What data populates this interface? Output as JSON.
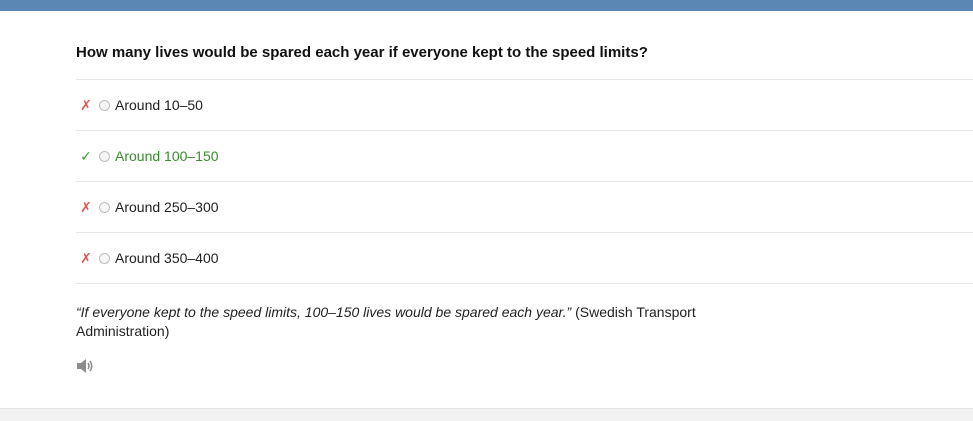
{
  "question": {
    "text": "How many lives would be spared each year if everyone kept to the speed limits?"
  },
  "options": [
    {
      "label": "Around 10–50",
      "mark": "✗",
      "correct": false
    },
    {
      "label": "Around 100–150",
      "mark": "✓",
      "correct": true
    },
    {
      "label": "Around 250–300",
      "mark": "✗",
      "correct": false
    },
    {
      "label": "Around 350–400",
      "mark": "✗",
      "correct": false
    }
  ],
  "explanation": {
    "quote": "“If everyone kept to the speed limits, 100–150 lives would be spared each year.”",
    "source": " (Swedish Transport Administration)"
  },
  "audio": {
    "icon": "speaker-icon"
  },
  "colors": {
    "topbar": "#5b87b5",
    "correct": "#3b8a2e",
    "wrong_mark": "#e05656",
    "check_mark": "#3a9a3a"
  }
}
